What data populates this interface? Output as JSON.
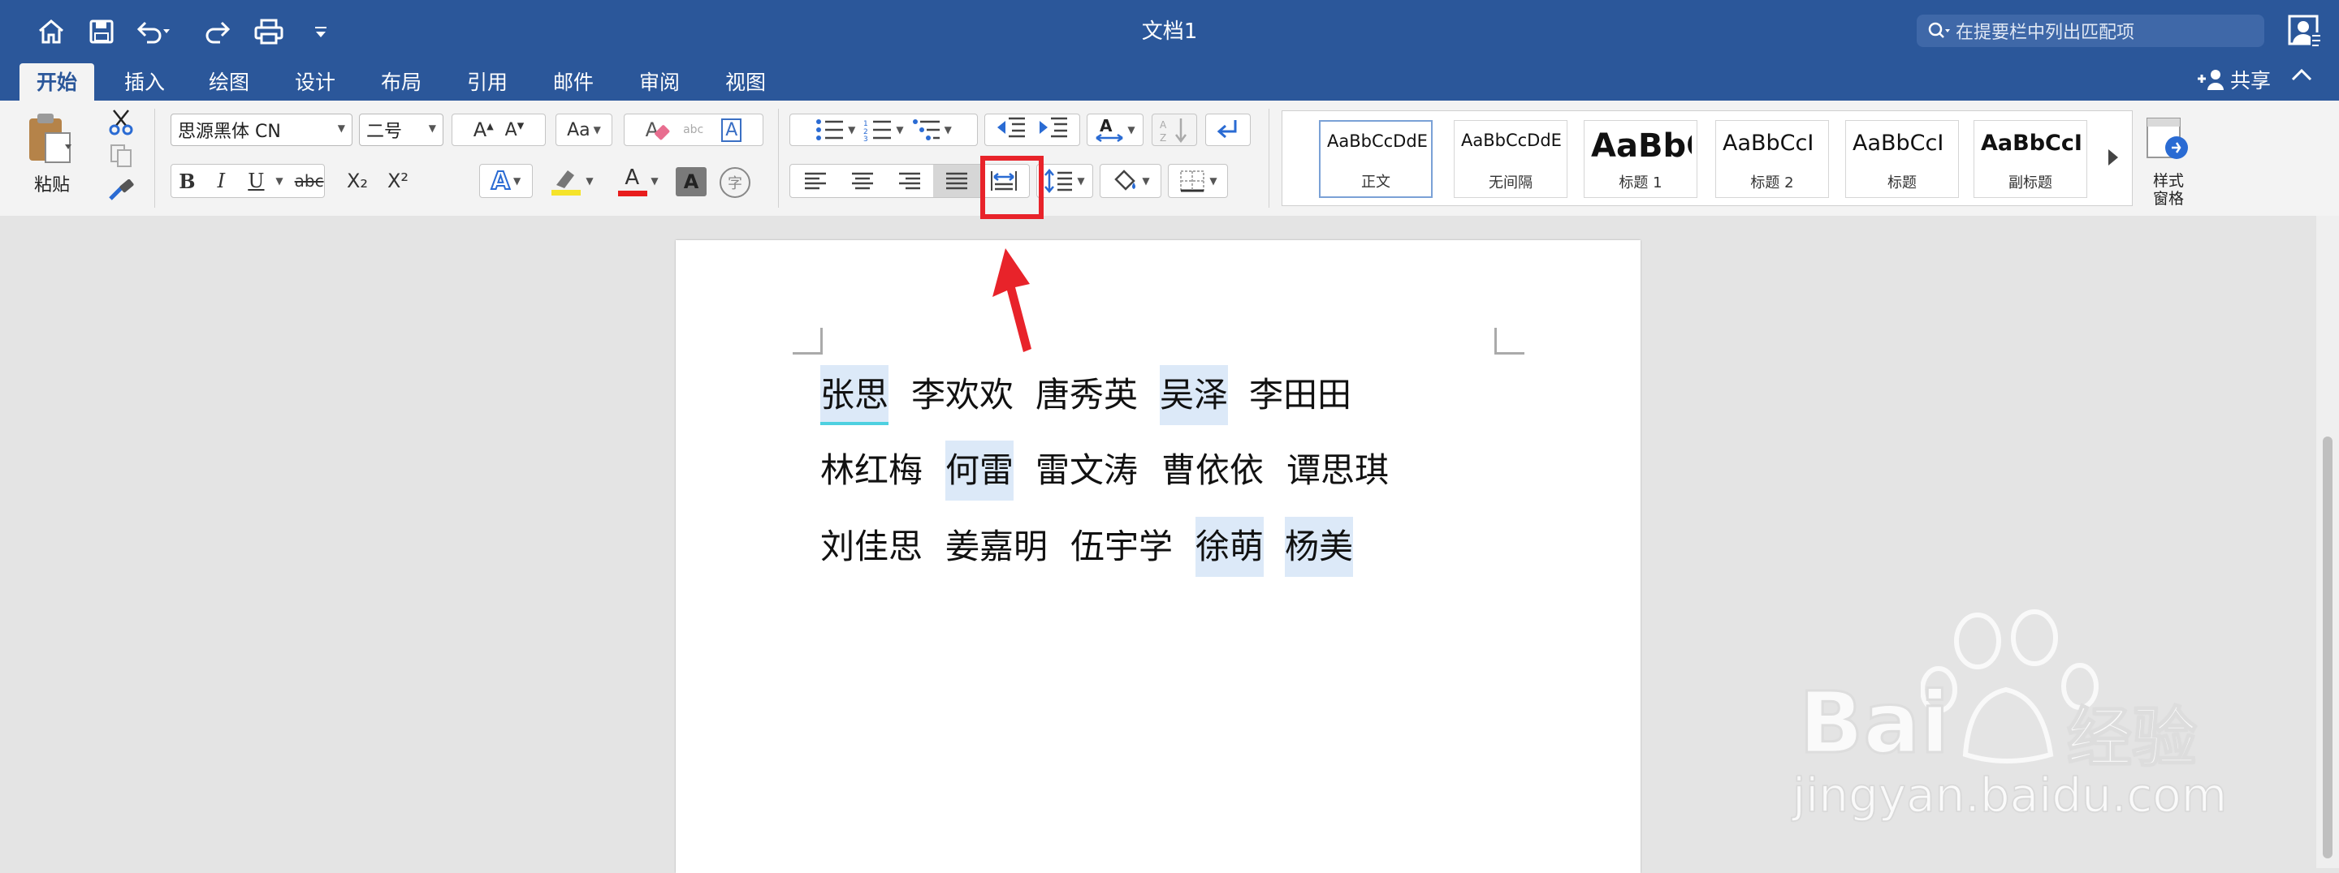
{
  "titlebar": {
    "doc_title": "文档1",
    "search_placeholder": "在提要栏中列出匹配项"
  },
  "tabs": [
    "开始",
    "插入",
    "绘图",
    "设计",
    "布局",
    "引用",
    "邮件",
    "审阅",
    "视图"
  ],
  "share_label": "共享",
  "clipboard": {
    "paste_label": "粘贴"
  },
  "font": {
    "family": "思源黑体 CN",
    "size": "二号",
    "bold": "B",
    "italic": "I",
    "underline": "U",
    "strike": "abc",
    "subscript": "X₂",
    "superscript": "X²",
    "font_color_letter": "A",
    "char_shading": "A",
    "enclose": "字",
    "grow": "A",
    "shrink": "A",
    "change_case": "Aa",
    "clear_format": "A",
    "phonetic": "abc",
    "char_border": "A"
  },
  "styles": [
    {
      "sample": "AaBbCcDdEe",
      "name": "正文"
    },
    {
      "sample": "AaBbCcDdEe",
      "name": "无间隔"
    },
    {
      "sample": "AaBbC(",
      "name": "标题 1"
    },
    {
      "sample": "AaBbCcI",
      "name": "标题 2"
    },
    {
      "sample": "AaBbCcI",
      "name": "标题"
    },
    {
      "sample": "AaBbCcI",
      "name": "副标题"
    }
  ],
  "styles_pane_label_1": "样式",
  "styles_pane_label_2": "窗格",
  "document": {
    "lines": [
      [
        {
          "text": "张思",
          "hl": true
        },
        {
          "text": "李欢欢",
          "hl": false
        },
        {
          "text": "唐秀英",
          "hl": false
        },
        {
          "text": "吴泽",
          "hl": true
        },
        {
          "text": "李田田",
          "hl": false
        }
      ],
      [
        {
          "text": "林红梅",
          "hl": false
        },
        {
          "text": "何雷",
          "hl": true
        },
        {
          "text": "雷文涛",
          "hl": false
        },
        {
          "text": "曹依依",
          "hl": false
        },
        {
          "text": "谭思琪",
          "hl": false
        }
      ],
      [
        {
          "text": "刘佳思",
          "hl": false
        },
        {
          "text": "姜嘉明",
          "hl": false
        },
        {
          "text": "伍宇学",
          "hl": false
        },
        {
          "text": "徐萌",
          "hl": true
        },
        {
          "text": "杨美",
          "hl": true
        }
      ]
    ]
  },
  "watermark": {
    "brand": "Bai",
    "brand2": "经验",
    "url": "jingyan.baidu.com"
  },
  "colors": {
    "titlebar": "#2b579a",
    "highlight": "#dce9f8",
    "annotation": "#e8232a"
  }
}
